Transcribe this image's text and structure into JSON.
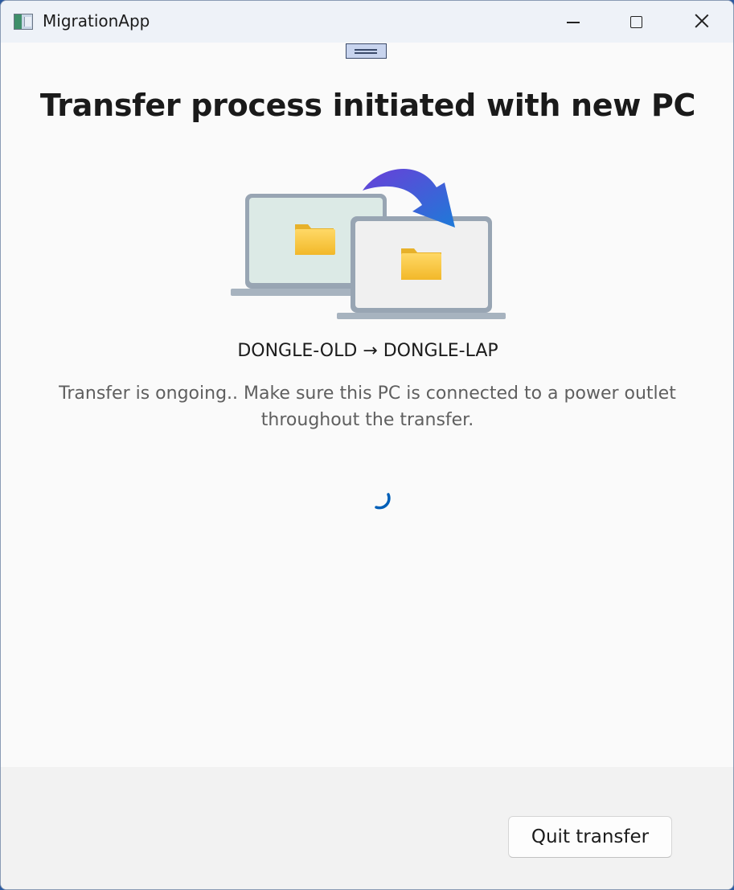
{
  "window": {
    "title": "MigrationApp"
  },
  "main": {
    "heading": "Transfer process initiated with new PC",
    "devices_label": "DONGLE-OLD → DONGLE-LAP",
    "message": "Transfer is ongoing.. Make sure this PC is connected to a power outlet throughout the transfer."
  },
  "footer": {
    "quit_label": "Quit transfer"
  },
  "colors": {
    "accent": "#005fb8",
    "arrow_start": "#5b3fd6",
    "arrow_end": "#1e7ad8",
    "folder": "#f7c948"
  }
}
